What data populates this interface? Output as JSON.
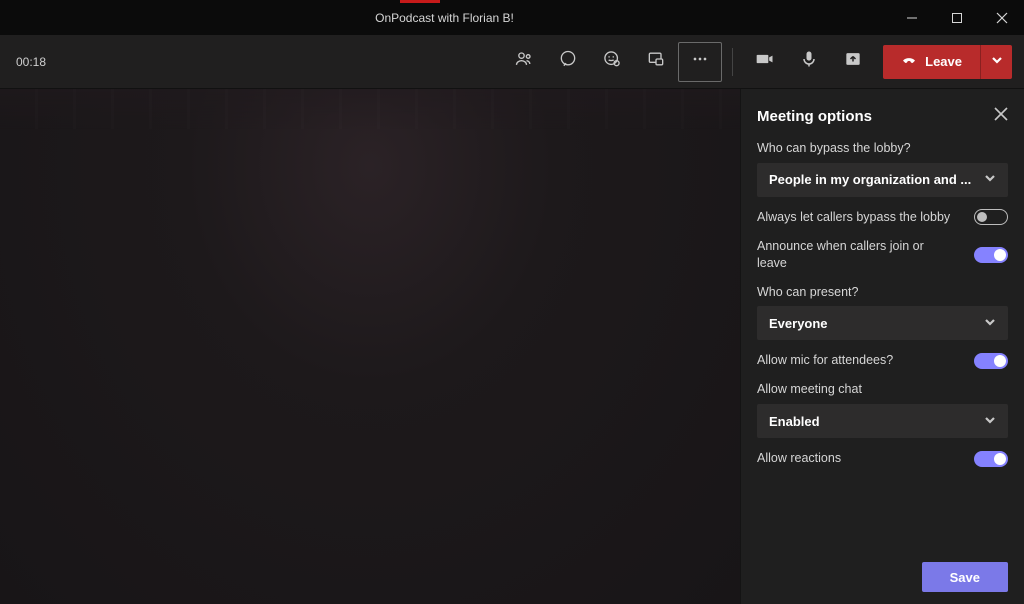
{
  "window": {
    "title": "OnPodcast with Florian B!"
  },
  "toolbar": {
    "timer": "00:18",
    "leave_label": "Leave"
  },
  "panel": {
    "title": "Meeting options",
    "lobby": {
      "label": "Who can bypass the lobby?",
      "value": "People in my organization and ..."
    },
    "callers_bypass": {
      "label": "Always let callers bypass the lobby",
      "on": false
    },
    "announce": {
      "label": "Announce when callers join or leave",
      "on": true
    },
    "present": {
      "label": "Who can present?",
      "value": "Everyone"
    },
    "allow_mic": {
      "label": "Allow mic for attendees?",
      "on": true
    },
    "chat": {
      "label": "Allow meeting chat",
      "value": "Enabled"
    },
    "reactions": {
      "label": "Allow reactions",
      "on": true
    },
    "save_label": "Save"
  }
}
